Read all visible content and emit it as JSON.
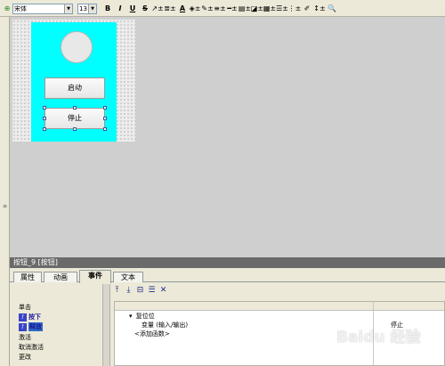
{
  "toolbar": {
    "font_name": "宋体",
    "font_size": "13",
    "bold": "B",
    "italic": "I",
    "underline": "U",
    "strike": "S",
    "text_color": "A"
  },
  "canvas": {
    "panel_color": "#00ffff",
    "start_button_label": "启动",
    "stop_button_label": "停止"
  },
  "properties": {
    "title": "按钮_9 [按钮]",
    "tabs": [
      {
        "label": "属性"
      },
      {
        "label": "动画"
      },
      {
        "label": "事件"
      },
      {
        "label": "文本"
      }
    ],
    "active_tab": "事件",
    "events": [
      {
        "label": "单击"
      },
      {
        "label": "按下"
      },
      {
        "label": "释放"
      },
      {
        "label": "激活"
      },
      {
        "label": "取消激活"
      },
      {
        "label": "更改"
      }
    ],
    "function_list": {
      "function_name": "复位位",
      "param_name": "变量 (输入/输出)",
      "param_value": "停止",
      "add_function": "<添加函数>"
    }
  },
  "watermark": "Baidu 经验"
}
